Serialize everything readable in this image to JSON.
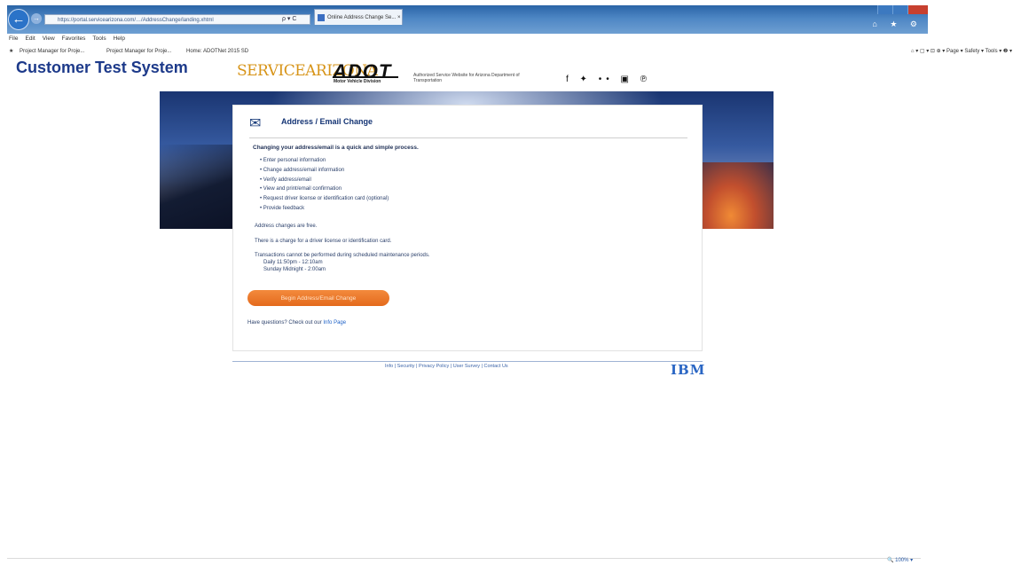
{
  "browser": {
    "url": "https://portal.servicearizona.com/…/AddressChange/landing.xhtml",
    "tab_title": "Online Address Change Se... ×",
    "address_controls": "ρ ▾ C",
    "menu": [
      "File",
      "Edit",
      "View",
      "Favorites",
      "Tools",
      "Help"
    ],
    "favorites": [
      "Project Manager for Proje...",
      "Project Manager for Proje...",
      "Home: ADOTNet 2015 SD"
    ],
    "command_bar": "⌂ ▾ ▢ ▾ ⊡ ⊕ ▾ Page ▾ Safety ▾ Tools ▾ ❷ ▾",
    "nav_icons": "⌂ ★ ⚙",
    "zoom": "🔍 100% ▾"
  },
  "header": {
    "site_title": "Customer Test System",
    "service_arizona": "SERVICEARIZONA",
    "adot": "ADOT",
    "adot_sub": "Motor Vehicle Division",
    "authorized": "Authorized Service Website for Arizona Department of Transportation",
    "social": "f ✦ •• ▣ ℗"
  },
  "card": {
    "title": "Address / Email Change",
    "intro": "Changing your address/email is a quick and simple process.",
    "steps": [
      "Enter personal information",
      "Change address/email information",
      "Verify address/email",
      "View and print/email confirmation",
      "Request driver license or identification card (optional)",
      "Provide feedback"
    ],
    "free_note": "Address changes are free.",
    "charge_note": "There is a charge for a driver license or identification card.",
    "maintenance_note": "Transactions cannot be performed during scheduled maintenance periods.",
    "hours_daily": "Daily     11:50pm - 12:10am",
    "hours_sunday": "Sunday   Midnight - 2:00am",
    "begin_button": "Begin Address/Email Change",
    "questions_prefix": "Have questions? Check out our ",
    "info_link": "Info Page"
  },
  "footer": {
    "links": "Info  |  Security  |  Privacy Policy  |  User Survey  |  Contact Us",
    "ibm": "IBM"
  },
  "colors": {
    "title_blue": "#1d3a8a",
    "button_orange": "#e46a1c",
    "servicearizona_gold": "#d79418"
  }
}
